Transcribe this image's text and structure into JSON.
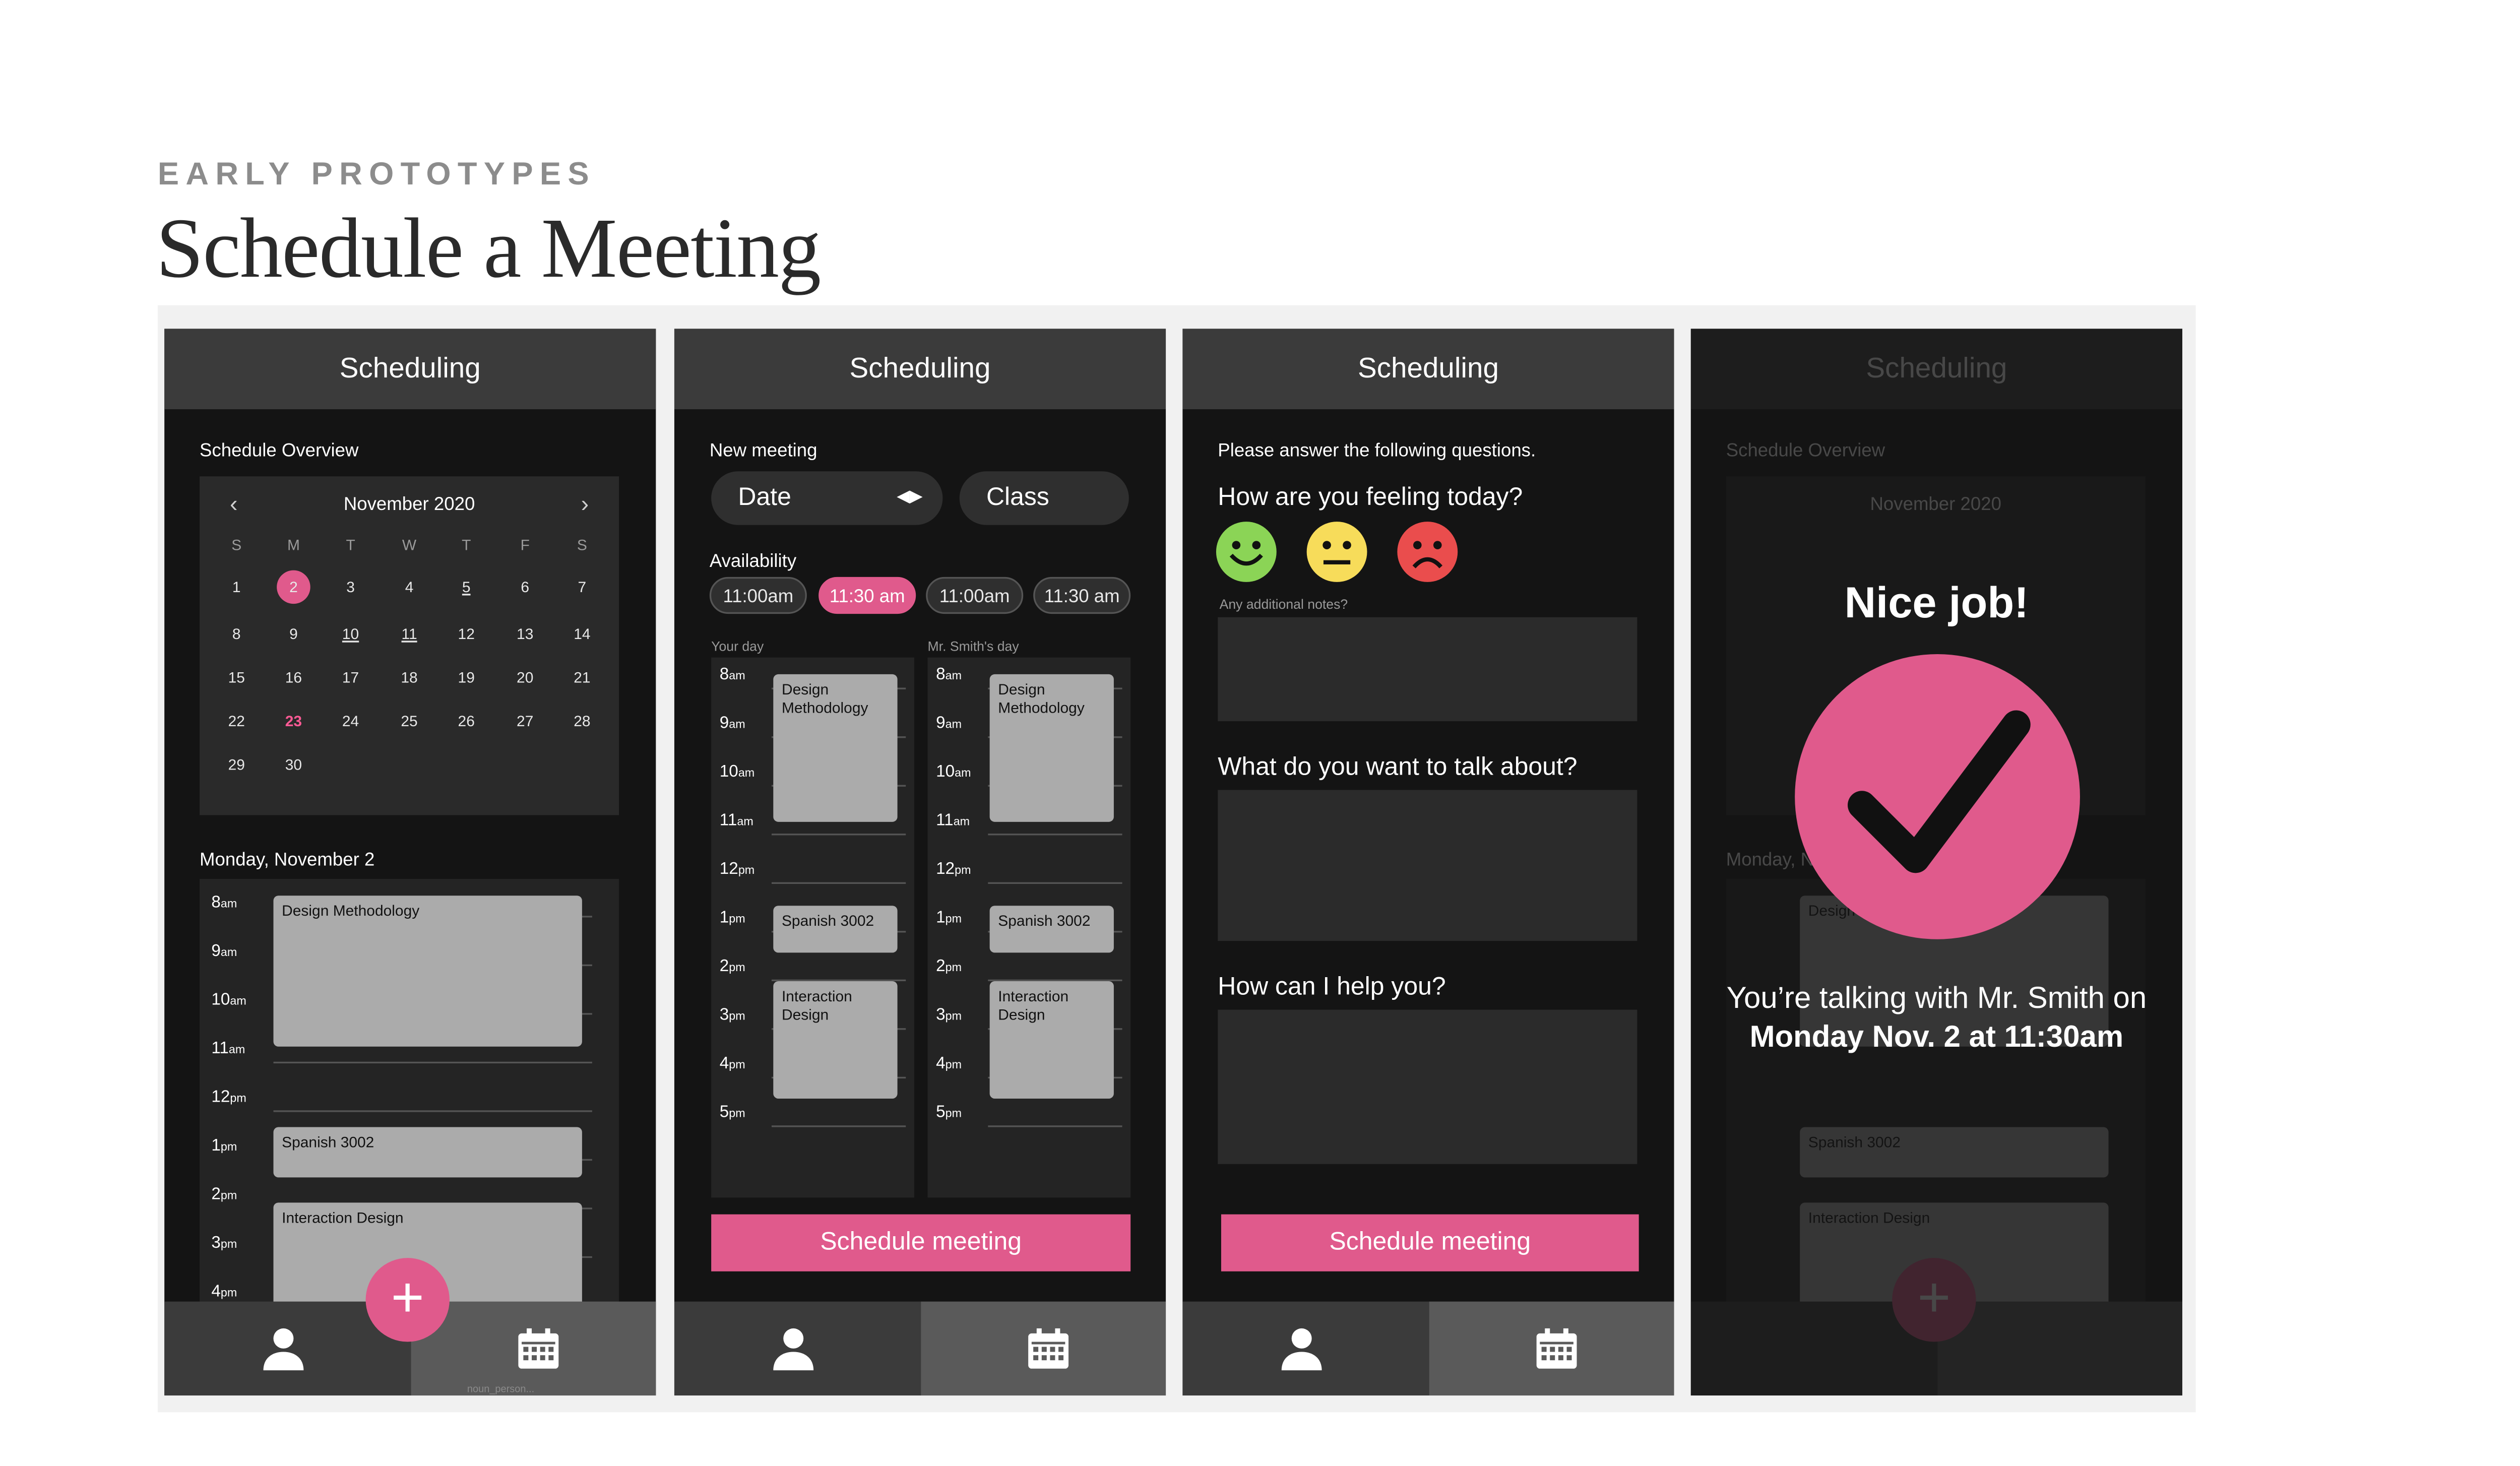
{
  "header": {
    "eyebrow": "EARLY PROTOTYPES",
    "title": "Schedule a Meeting"
  },
  "colors": {
    "accent": "#e05a8c",
    "screen_bg": "#141414",
    "header_bg": "#3b3b3b"
  },
  "screen_title": "Scheduling",
  "screen1": {
    "section": "Schedule Overview",
    "month": "November 2020",
    "weekdays": [
      "S",
      "M",
      "T",
      "W",
      "T",
      "F",
      "S"
    ],
    "weeks": [
      [
        "",
        "",
        "",
        "",
        "",
        "",
        ""
      ],
      [
        "1",
        "2",
        "3",
        "4",
        "5",
        "6",
        "7"
      ],
      [
        "8",
        "9",
        "10",
        "11",
        "12",
        "13",
        "14"
      ],
      [
        "15",
        "16",
        "17",
        "18",
        "19",
        "20",
        "21"
      ],
      [
        "22",
        "23",
        "24",
        "25",
        "26",
        "27",
        "28"
      ],
      [
        "29",
        "30",
        "",
        "",
        "",
        "",
        ""
      ]
    ],
    "day_label": "Monday, November 2",
    "hours": [
      {
        "h": "8",
        "s": "am"
      },
      {
        "h": "9",
        "s": "am"
      },
      {
        "h": "10",
        "s": "am"
      },
      {
        "h": "11",
        "s": "am"
      },
      {
        "h": "12",
        "s": "pm"
      },
      {
        "h": "1",
        "s": "pm"
      },
      {
        "h": "2",
        "s": "pm"
      },
      {
        "h": "3",
        "s": "pm"
      },
      {
        "h": "4",
        "s": "pm"
      }
    ],
    "events": [
      "Design Methodology",
      "Spanish 3002",
      "Interaction Design"
    ],
    "fab": "+",
    "caption": "noun_person..."
  },
  "screen2": {
    "section": "New meeting",
    "date_label": "Date",
    "class_label": "Class",
    "availability": "Availability",
    "slots": [
      "11:00am",
      "11:30 am",
      "11:00am",
      "11:30 am"
    ],
    "your_day": "Your day",
    "their_day": "Mr. Smith's day",
    "hours": [
      {
        "h": "8",
        "s": "am"
      },
      {
        "h": "9",
        "s": "am"
      },
      {
        "h": "10",
        "s": "am"
      },
      {
        "h": "11",
        "s": "am"
      },
      {
        "h": "12",
        "s": "pm"
      },
      {
        "h": "1",
        "s": "pm"
      },
      {
        "h": "2",
        "s": "pm"
      },
      {
        "h": "3",
        "s": "pm"
      },
      {
        "h": "4",
        "s": "pm"
      },
      {
        "h": "5",
        "s": "pm"
      }
    ],
    "events": [
      "Design Methodology",
      "Spanish 3002",
      "Interaction Design"
    ],
    "cta": "Schedule meeting"
  },
  "screen3": {
    "intro": "Please answer the following questions.",
    "q1": "How are you feeling today?",
    "notes_hint": "Any additional notes?",
    "q2": "What do you want to talk about?",
    "q3": "How can I help you?",
    "cta": "Schedule meeting"
  },
  "screen4": {
    "nice": "Nice job!",
    "talk_prefix": "You’re talking with Mr. Smith on ",
    "talk_bold1": "Monday Nov. 2",
    "talk_mid": " ",
    "talk_bold2": "at 11:30am"
  }
}
